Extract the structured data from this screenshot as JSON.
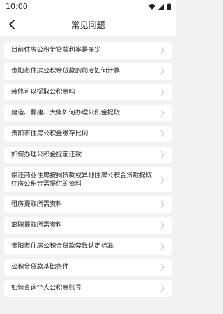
{
  "status": {
    "time": "10:00"
  },
  "header": {
    "title": "常见问题"
  },
  "faq": [
    "目前住房公积金贷款利率是多少",
    "贵阳市住房公积金贷款的额度如何计算",
    "装修可以提取公积金吗",
    "建造、翻建、大修如何办理公积金提取",
    "贵阳市住房公积金缴存比例",
    "如何办理公积金提前还款",
    "偿还商业住房按揭贷款或异地住房公积金贷款提取住房公积金需提供的资料",
    "租房提取所需资料",
    "离职提取所需资料",
    "贵阳市住房公积金贷款套数认定标准",
    "公积金贷款基础条件",
    "如何查询个人公积金账号"
  ],
  "colors": {
    "background": "#f2f2f2",
    "card": "#ffffff",
    "chevron": "#c7c7c7"
  },
  "icons": {
    "status": [
      "wifi-icon",
      "signal-icon",
      "battery-icon"
    ],
    "back": "back-arrow-icon",
    "row": "chevron-right-icon"
  }
}
